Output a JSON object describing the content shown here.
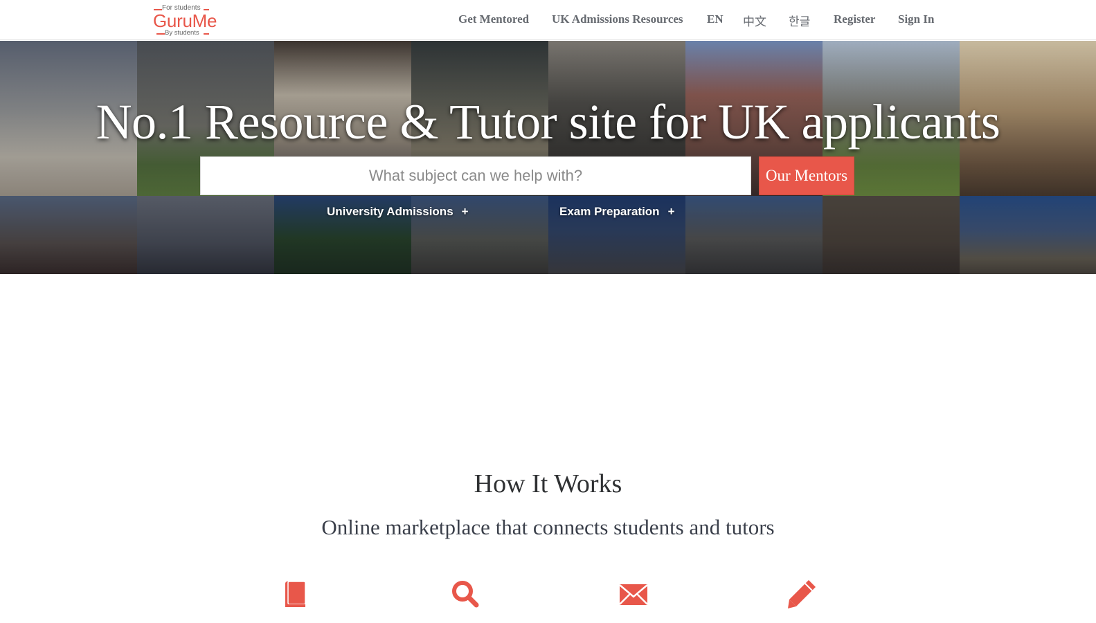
{
  "header": {
    "logo": {
      "top_text": "For students",
      "main_text": "GuruMe",
      "bottom_text": "By students"
    },
    "nav": [
      {
        "label": "Get Mentored"
      },
      {
        "label": "UK Admissions Resources"
      },
      {
        "label": "EN"
      },
      {
        "label": "中文"
      },
      {
        "label": "한글"
      },
      {
        "label": "Register"
      },
      {
        "label": "Sign In"
      }
    ]
  },
  "hero": {
    "title": "No.1 Resource & Tutor site for UK applicants",
    "search": {
      "placeholder": "What subject can we help with?",
      "value": ""
    },
    "search_button": "Our Mentors",
    "dropdowns": [
      {
        "label": "University Admissions",
        "icon": "+"
      },
      {
        "label": "Exam Preparation",
        "icon": "+"
      }
    ]
  },
  "how_it_works": {
    "title": "How It Works",
    "subtitle": "Online marketplace that connects students and tutors",
    "icons": [
      "book-icon",
      "search-icon",
      "envelope-icon",
      "pencil-icon"
    ]
  },
  "colors": {
    "accent": "#e8574a",
    "nav_text": "#666a70",
    "heading_text": "#2f3133"
  }
}
